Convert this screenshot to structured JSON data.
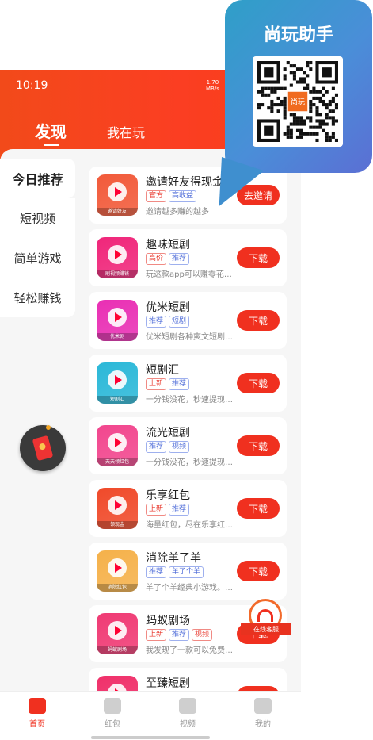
{
  "status_bar": {
    "time": "10:19",
    "net_speed_value": "1.70",
    "net_speed_unit": "MB/s"
  },
  "tabs": [
    {
      "label": "发现"
    },
    {
      "label": "我在玩"
    }
  ],
  "categories": [
    {
      "label": "今日推荐"
    },
    {
      "label": "短视频"
    },
    {
      "label": "简单游戏"
    },
    {
      "label": "轻松赚钱"
    }
  ],
  "apps": [
    {
      "name": "邀请好友得现金",
      "tags": [
        {
          "text": "官方",
          "color": "red"
        },
        {
          "text": "高收益",
          "color": "blue"
        }
      ],
      "desc": "邀请越多赚的越多",
      "button": "去邀请",
      "icon_caption": "邀请好友",
      "icon_color": "#f25a3a"
    },
    {
      "name": "趣味短剧",
      "tags": [
        {
          "text": "高价",
          "color": "red"
        },
        {
          "text": "推荐",
          "color": "blue"
        }
      ],
      "desc": "玩这款app可以赚零花…",
      "button": "下载",
      "icon_caption": "刷视频赚钱",
      "icon_color": "#f0267a"
    },
    {
      "name": "优米短剧",
      "tags": [
        {
          "text": "推荐",
          "color": "blue"
        },
        {
          "text": "短剧",
          "color": "blue"
        }
      ],
      "desc": "优米短剧各种爽文短剧…",
      "button": "下载",
      "icon_caption": "优米剧",
      "icon_color": "#e92fb4"
    },
    {
      "name": "短剧汇",
      "tags": [
        {
          "text": "上新",
          "color": "red"
        },
        {
          "text": "推荐",
          "color": "blue"
        }
      ],
      "desc": "一分钱没花，秒速提现…",
      "button": "下载",
      "icon_caption": "短剧汇",
      "icon_color": "#2bb8d8"
    },
    {
      "name": "流光短剧",
      "tags": [
        {
          "text": "推荐",
          "color": "blue"
        },
        {
          "text": "视频",
          "color": "blue"
        }
      ],
      "desc": "一分钱没花，秒速提现…",
      "button": "下载",
      "icon_caption": "天天领红包",
      "icon_color": "#f2468e"
    },
    {
      "name": "乐享红包",
      "tags": [
        {
          "text": "上新",
          "color": "red"
        },
        {
          "text": "推荐",
          "color": "blue"
        }
      ],
      "desc": "海量红包，尽在乐享红…",
      "button": "下载",
      "icon_caption": "领现金",
      "icon_color": "#f04a2a"
    },
    {
      "name": "消除羊了羊",
      "tags": [
        {
          "text": "推荐",
          "color": "blue"
        },
        {
          "text": "羊了个羊",
          "color": "blue"
        }
      ],
      "desc": "羊了个羊经典小游戏。…",
      "button": "下载",
      "icon_caption": "消除红包",
      "icon_color": "#f5b14a"
    },
    {
      "name": "蚂蚁剧场",
      "tags": [
        {
          "text": "上新",
          "color": "red"
        },
        {
          "text": "推荐",
          "color": "blue"
        },
        {
          "text": "视频",
          "color": "red"
        }
      ],
      "desc": "我发现了一款可以免费…",
      "button": "下载",
      "icon_caption": "蚂蚁剧场",
      "icon_color": "#f03a74"
    },
    {
      "name": "至臻短剧",
      "tags": [],
      "desc": "",
      "button": "下载",
      "icon_caption": "",
      "icon_color": "#f0306a"
    }
  ],
  "service_badge": {
    "label": "在线客服"
  },
  "bottom_nav": [
    {
      "label": "首页",
      "icon": "home-icon",
      "active": true
    },
    {
      "label": "红包",
      "icon": "red-packet-icon",
      "active": false
    },
    {
      "label": "视频",
      "icon": "video-icon",
      "active": false
    },
    {
      "label": "我的",
      "icon": "user-icon",
      "active": false
    }
  ],
  "overlay": {
    "title": "尚玩助手",
    "qr_label": "尚玩"
  },
  "colors": {
    "accent": "#f0301f",
    "header": "#f64018",
    "bubble": "#3f8fcf"
  }
}
